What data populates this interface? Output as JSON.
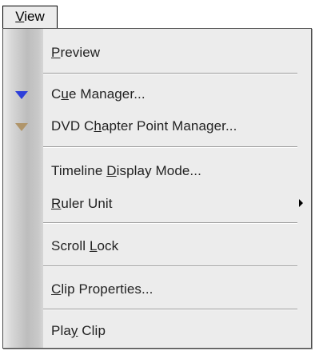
{
  "menubar": {
    "menu": {
      "pre": "",
      "mnemonic": "V",
      "post": "iew"
    }
  },
  "menu_items": [
    {
      "pre": "",
      "mnemonic": "P",
      "post": "review",
      "icon": null,
      "submenu": false
    },
    {
      "pre": "C",
      "mnemonic": "u",
      "post": "e Manager...",
      "icon": "cue-marker-icon",
      "icon_color": "#2d3fd9",
      "submenu": false
    },
    {
      "pre": "DVD C",
      "mnemonic": "h",
      "post": "apter Point Manager...",
      "icon": "chapter-marker-icon",
      "icon_color": "#b0956a",
      "submenu": false
    },
    {
      "pre": "Timeline ",
      "mnemonic": "D",
      "post": "isplay Mode...",
      "icon": null,
      "submenu": false
    },
    {
      "pre": "",
      "mnemonic": "R",
      "post": "uler Unit",
      "icon": null,
      "submenu": true
    },
    {
      "pre": "Scroll ",
      "mnemonic": "L",
      "post": "ock",
      "icon": null,
      "submenu": false
    },
    {
      "pre": "",
      "mnemonic": "C",
      "post": "lip Properties...",
      "icon": null,
      "submenu": false
    },
    {
      "pre": "Pla",
      "mnemonic": "y",
      "post": " Clip",
      "icon": null,
      "submenu": false
    }
  ]
}
